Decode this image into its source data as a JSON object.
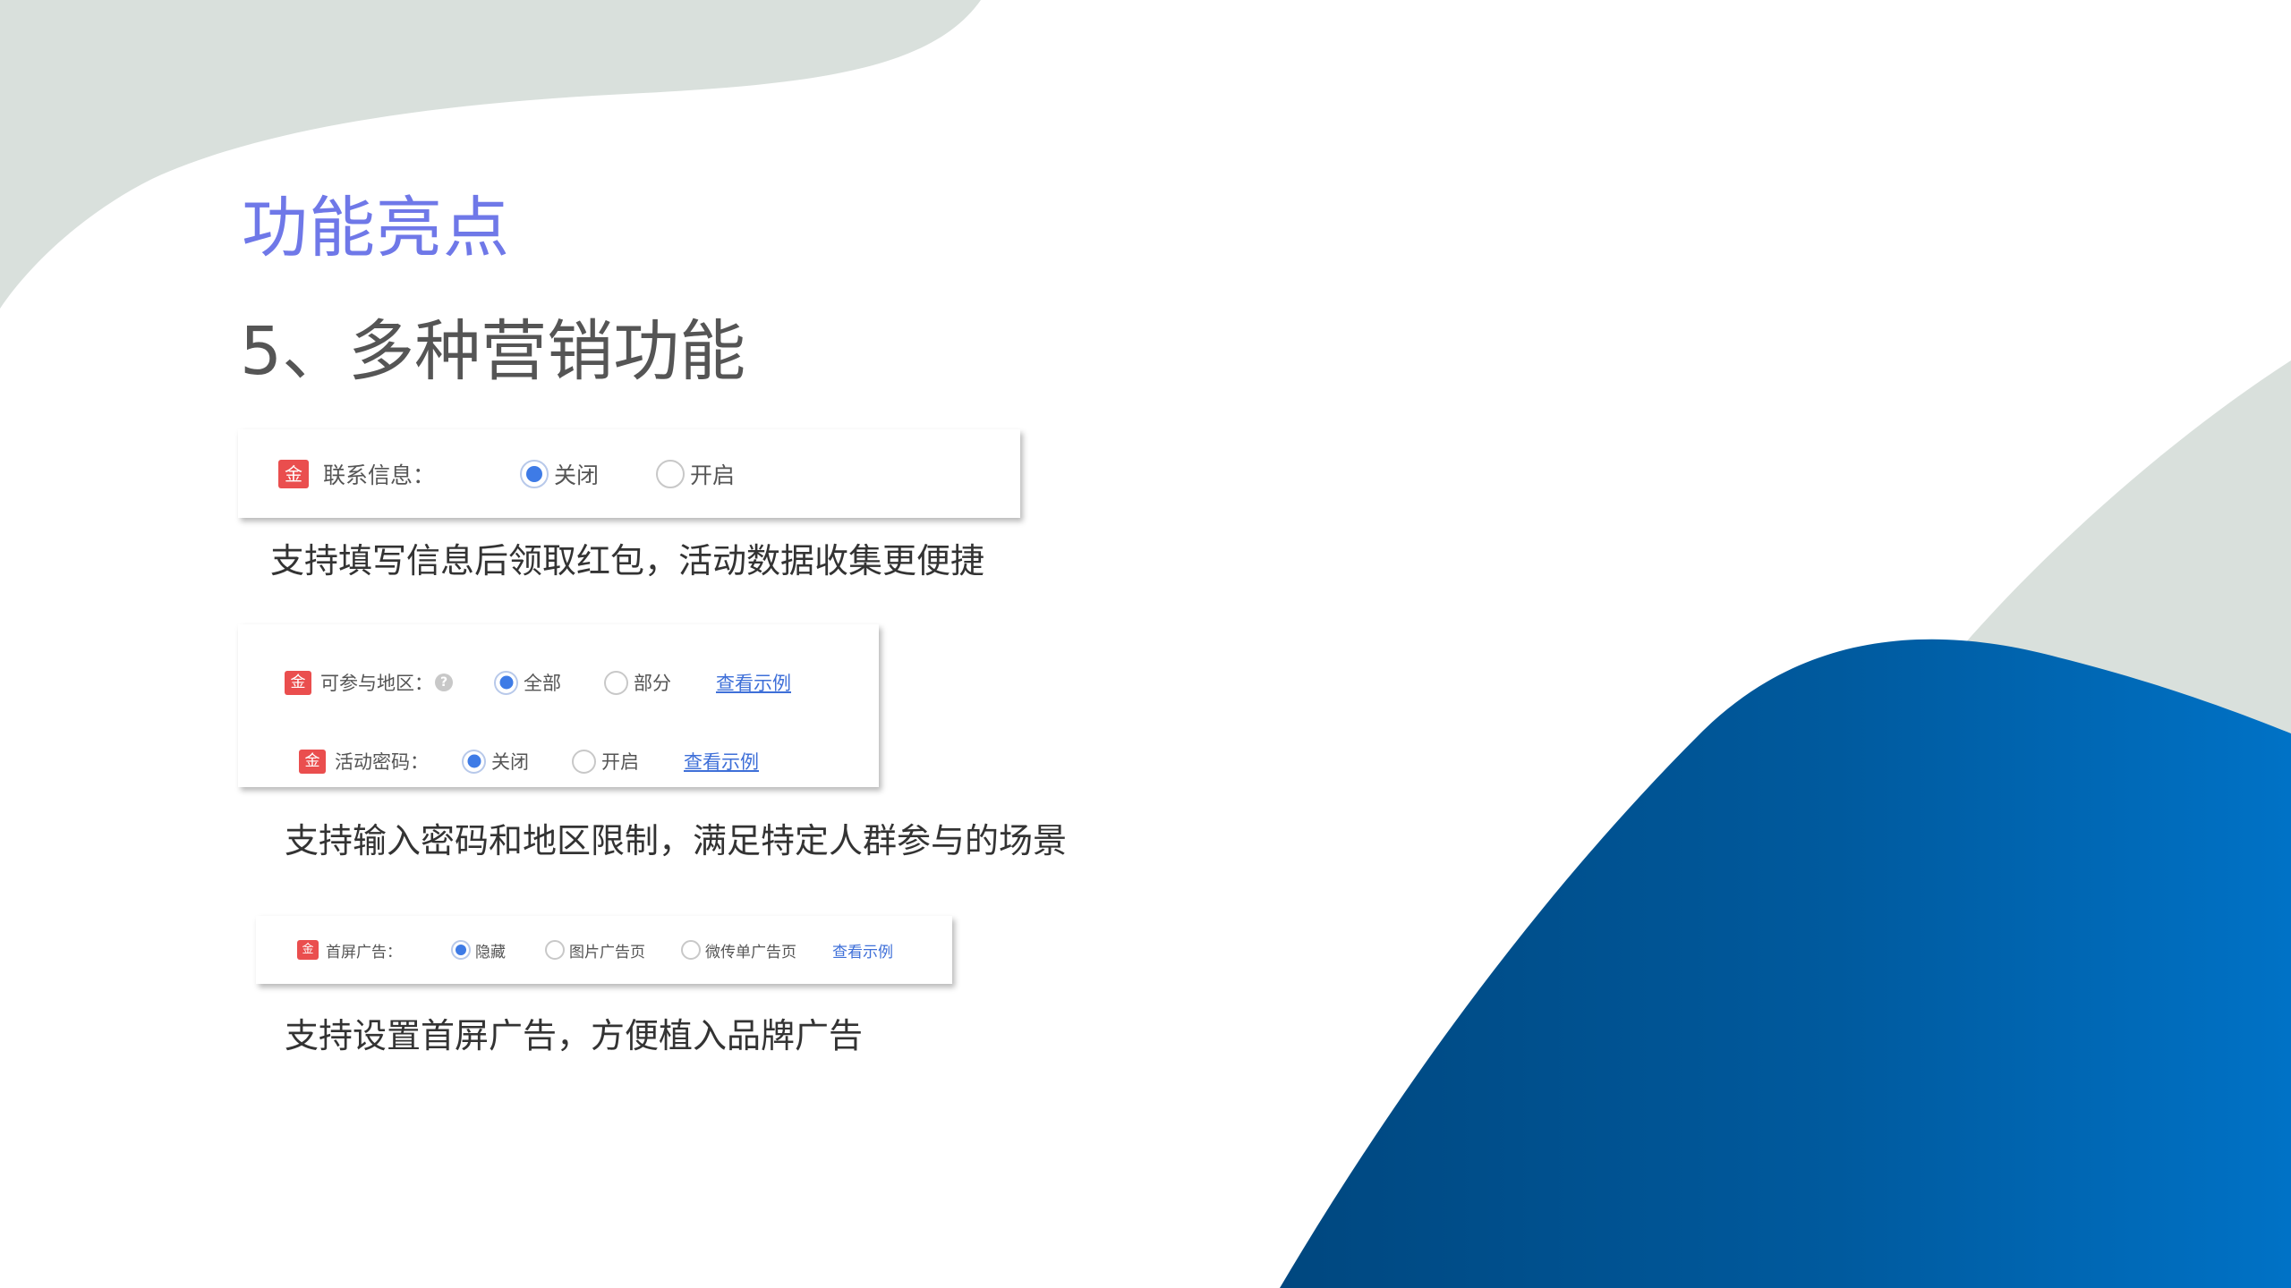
{
  "slide": {
    "title": "功能亮点",
    "subtitle": "5、多种营销功能"
  },
  "colors": {
    "title": "#6f78e8",
    "accent_blue": "#3e7be6",
    "badge_red": "#ea4e4e",
    "blob_grey": "#d9e0dc",
    "blob_blue": "#0067b4"
  },
  "panel_contact": {
    "badge": "金",
    "label": "联系信息：",
    "options": [
      {
        "label": "关闭",
        "checked": true
      },
      {
        "label": "开启",
        "checked": false
      }
    ]
  },
  "desc_contact": "支持填写信息后领取红包，活动数据收集更便捷",
  "panel_region_password": {
    "region": {
      "badge": "金",
      "label": "可参与地区：",
      "help_icon": "?",
      "options": [
        {
          "label": "全部",
          "checked": true
        },
        {
          "label": "部分",
          "checked": false
        }
      ],
      "link": "查看示例"
    },
    "password": {
      "badge": "金",
      "label": "活动密码：",
      "options": [
        {
          "label": "关闭",
          "checked": true
        },
        {
          "label": "开启",
          "checked": false
        }
      ],
      "link": "查看示例"
    }
  },
  "desc_region_password": "支持输入密码和地区限制，满足特定人群参与的场景",
  "panel_splash_ad": {
    "badge": "金",
    "label": "首屏广告：",
    "options": [
      {
        "label": "隐藏",
        "checked": true
      },
      {
        "label": "图片广告页",
        "checked": false
      },
      {
        "label": "微传单广告页",
        "checked": false
      }
    ],
    "link": "查看示例"
  },
  "desc_splash_ad": "支持设置首屏广告，方便植入品牌广告"
}
